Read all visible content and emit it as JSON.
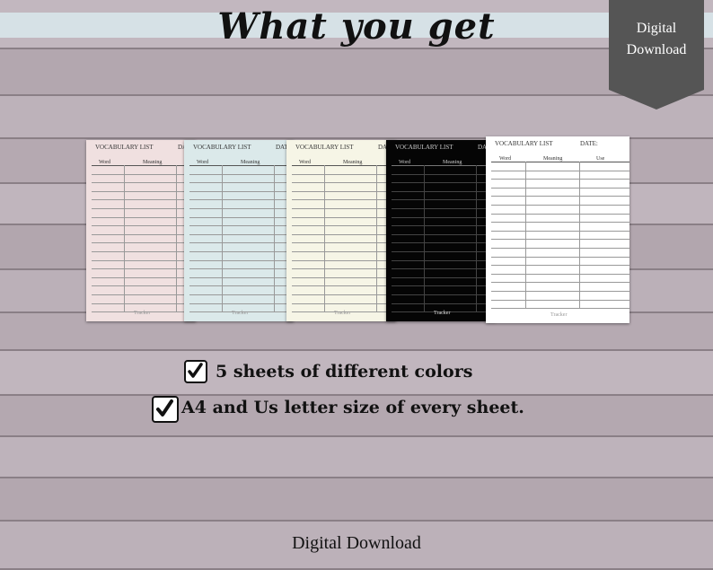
{
  "header": {
    "title": "What you get"
  },
  "badge": {
    "line1": "Digital",
    "line2": "Download"
  },
  "sheets": [
    {
      "color": "#f0e0e0",
      "ink": "#333",
      "header": "VOCABULARY LIST",
      "date": "DA",
      "col1": "Word",
      "col2": "Meaning",
      "col3": "",
      "footer": "Tracker"
    },
    {
      "color": "#dbe9ea",
      "ink": "#333",
      "header": "VOCABULARY LIST",
      "date": "DAT",
      "col1": "Word",
      "col2": "Meaning",
      "col3": "",
      "footer": "Tracker"
    },
    {
      "color": "#f6f5e6",
      "ink": "#333",
      "header": "VOCABULARY LIST",
      "date": "DA",
      "col1": "Word",
      "col2": "Meaning",
      "col3": "",
      "footer": "Tracker"
    },
    {
      "color": "#050505",
      "ink": "#ccc",
      "header": "VOCABULARY LIST",
      "date": "DA",
      "col1": "Word",
      "col2": "Meaning",
      "col3": "",
      "footer": "Tracker"
    },
    {
      "color": "#ffffff",
      "ink": "#333",
      "header": "VOCABULARY LIST",
      "date": "DATE:",
      "col1": "Word",
      "col2": "Meaning",
      "col3": "Use",
      "footer": "Tracker"
    }
  ],
  "features": [
    {
      "text": "5 sheets of different colors"
    },
    {
      "text": "A4 and Us letter size of every sheet."
    }
  ],
  "footer": {
    "text": "Digital Download"
  }
}
